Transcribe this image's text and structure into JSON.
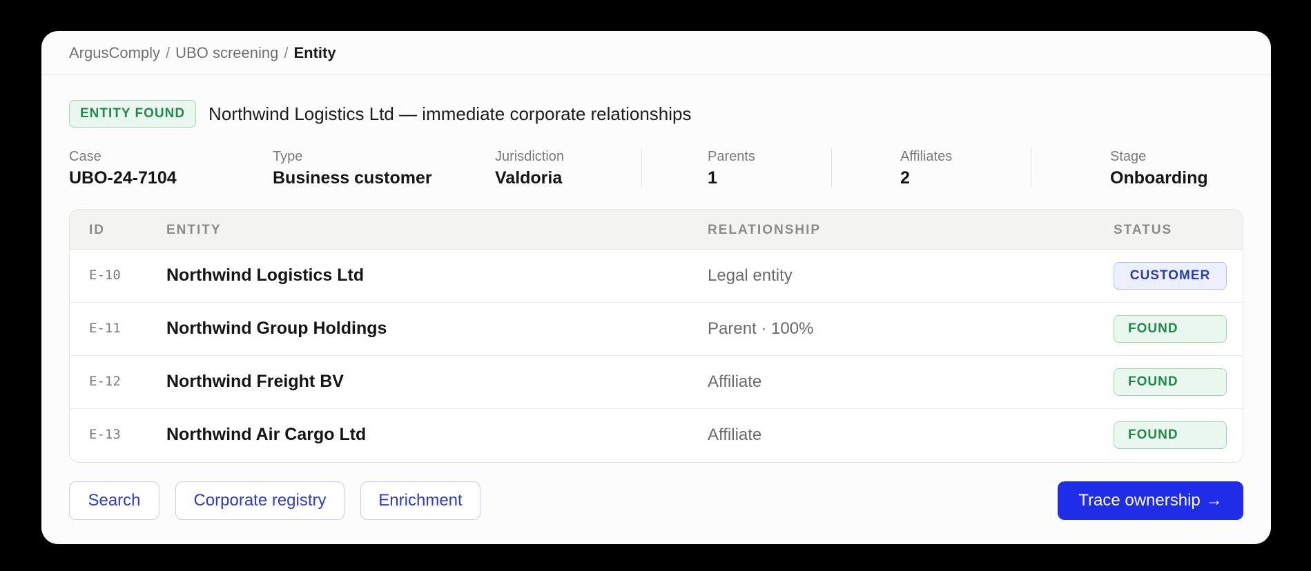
{
  "breadcrumb": {
    "items": [
      "ArgusComply",
      "UBO screening"
    ],
    "separator": "/",
    "current": "Entity"
  },
  "header": {
    "badge": "ENTITY FOUND",
    "title": "Northwind Logistics Ltd — immediate corporate relationships"
  },
  "meta": {
    "case": {
      "label": "Case",
      "value": "UBO-24-7104"
    },
    "type": {
      "label": "Type",
      "value": "Business customer"
    },
    "jurisdiction": {
      "label": "Jurisdiction",
      "value": "Valdoria"
    },
    "parents": {
      "label": "Parents",
      "value": "1"
    },
    "affiliates": {
      "label": "Affiliates",
      "value": "2"
    },
    "stage": {
      "label": "Stage",
      "value": "Onboarding"
    }
  },
  "table": {
    "columns": {
      "id": "ID",
      "entity": "ENTITY",
      "relationship": "RELATIONSHIP",
      "status": "STATUS"
    },
    "rows": [
      {
        "id": "E-10",
        "entity": "Northwind Logistics Ltd",
        "relationship": "Legal entity",
        "status": "CUSTOMER"
      },
      {
        "id": "E-11",
        "entity": "Northwind Group Holdings",
        "relationship": "Parent · 100%",
        "status": "FOUND"
      },
      {
        "id": "E-12",
        "entity": "Northwind Freight BV",
        "relationship": "Affiliate",
        "status": "FOUND"
      },
      {
        "id": "E-13",
        "entity": "Northwind Air Cargo Ltd",
        "relationship": "Affiliate",
        "status": "FOUND"
      }
    ]
  },
  "actions": {
    "search": "Search",
    "registry": "Corporate registry",
    "enrichment": "Enrichment",
    "primary": "Trace ownership",
    "primary_arrow": "→"
  },
  "colors": {
    "accent": "#1f2ce8",
    "found": "#1f8a4a",
    "customer": "#2a3bb8"
  }
}
